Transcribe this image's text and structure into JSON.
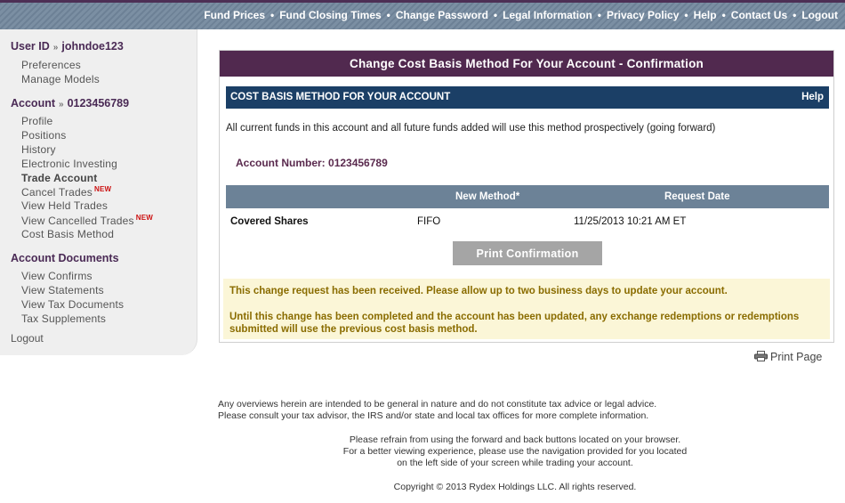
{
  "topnav": [
    "Fund Prices",
    "Fund Closing Times",
    "Change Password",
    "Legal Information",
    "Privacy Policy",
    "Help",
    "Contact Us",
    "Logout"
  ],
  "sidebar": {
    "user_label": "User ID",
    "user_id": "johndoe123",
    "user_items": [
      "Preferences",
      "Manage Models"
    ],
    "account_label": "Account",
    "account_number": "0123456789",
    "account_items": [
      "Profile",
      "Positions",
      "History",
      "Electronic Investing",
      "Trade Account",
      "Cancel Trades",
      "View Held Trades",
      "View Cancelled Trades",
      "Cost Basis Method"
    ],
    "new_badge": "NEW",
    "documents_label": "Account Documents",
    "document_items": [
      "View Confirms",
      "View Statements",
      "View Tax Documents",
      "Tax Supplements"
    ],
    "logout": "Logout"
  },
  "panel": {
    "title": "Change Cost Basis Method For Your Account - Confirmation",
    "section_title": "COST BASIS METHOD FOR YOUR ACCOUNT",
    "help": "Help",
    "intro": "All current funds in this account and all future funds added will use this method prospectively (going forward)",
    "account_number_label": "Account Number:",
    "account_number": "0123456789",
    "table": {
      "headers": [
        "",
        "New Method*",
        "Request Date"
      ],
      "row": [
        "Covered Shares",
        "FIFO",
        "11/25/2013 10:21 AM ET"
      ]
    },
    "print_button": "Print Confirmation",
    "notice1": "This change request has been received. Please allow up to two business days to update your account.",
    "notice2": "Until this change has been completed and the account has been updated, any exchange redemptions or redemptions submitted will use the previous cost basis method."
  },
  "print_page": "Print Page",
  "footer": {
    "disclaimer1": "Any overviews herein are intended to be general in nature and do not constitute tax advice or legal advice.",
    "disclaimer2": "Please consult your tax advisor, the IRS and/or state and local tax offices for more complete information.",
    "browser1": "Please refrain from using the forward and back buttons located on your browser.",
    "browser2": "For a better viewing experience, please use the navigation provided for you located",
    "browser3": "on the left side of your screen while trading your account.",
    "copyright": "Copyright © 2013 Rydex Holdings LLC. All rights reserved."
  },
  "colors": {
    "brand_purple": "#51294f",
    "section_navy": "#1b3f66",
    "table_header": "#6c8297",
    "notice_bg": "#fbf6d7",
    "notice_text": "#8a6c00",
    "new_badge": "#cc1111"
  }
}
